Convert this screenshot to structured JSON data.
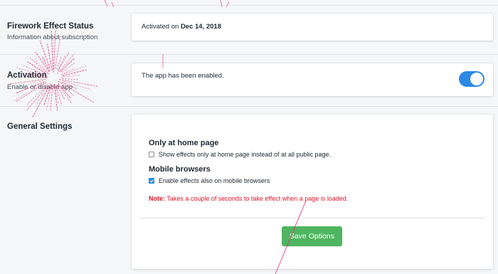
{
  "status": {
    "title": "Firework Effect Status",
    "description": "Information about subscription",
    "activated_prefix": "Activated on",
    "activated_date": "Dec 14, 2018"
  },
  "activation": {
    "title": "Activation",
    "description": "Enable or disable app",
    "message": "The app has been enabled.",
    "toggle_on": true
  },
  "general": {
    "title": "General Settings",
    "home_heading": "Only at home page",
    "home_option": "Show effects only at home page instead of at all public page.",
    "home_checked": false,
    "mobile_heading": "Mobile browsers",
    "mobile_option": "Enable effects also on mobile browsers",
    "mobile_checked": true,
    "note_label": "Note:",
    "note_text": "Takes a couple of seconds to take effect when a page is loaded.",
    "save_label": "Save Options"
  },
  "colors": {
    "accent": "#2b8ae5",
    "save": "#4fb561",
    "note": "#e0142a",
    "firework": "#e0306a"
  }
}
